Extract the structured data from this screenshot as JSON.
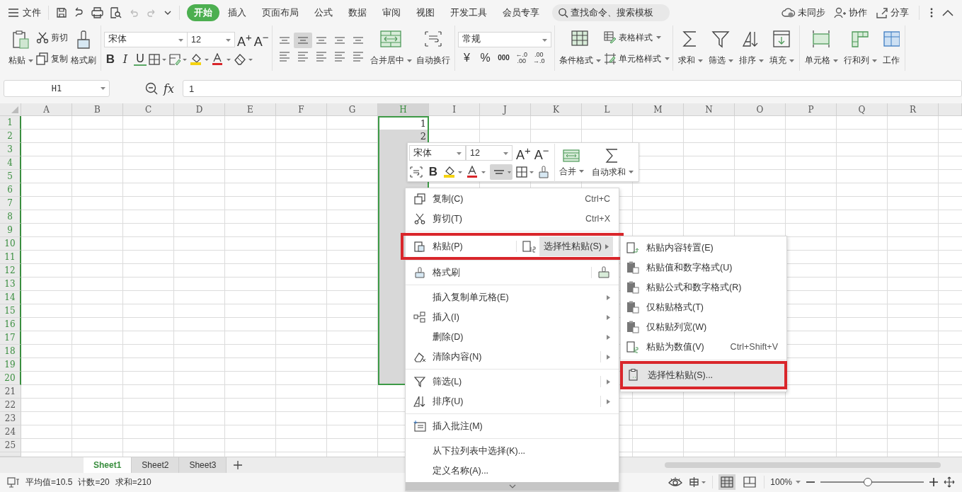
{
  "menu_bar": {
    "file": "文件",
    "tabs": [
      {
        "label": "开始",
        "selected": true
      },
      {
        "label": "插入",
        "selected": false
      },
      {
        "label": "页面布局",
        "selected": false
      },
      {
        "label": "公式",
        "selected": false
      },
      {
        "label": "数据",
        "selected": false
      },
      {
        "label": "审阅",
        "selected": false
      },
      {
        "label": "视图",
        "selected": false
      },
      {
        "label": "开发工具",
        "selected": false
      },
      {
        "label": "会员专享",
        "selected": false
      }
    ],
    "search": {
      "placeholder": "查找命令、搜索模板"
    },
    "actions": [
      "未同步",
      "协作",
      "分享"
    ]
  },
  "ribbon": {
    "clipboard": {
      "paste": "粘贴",
      "cut": "剪切",
      "copy": "复制",
      "painter": "格式刷"
    },
    "font": {
      "name": "宋体",
      "size": "12",
      "grow": "A$^{+}$",
      "shrink": "A$^{−}$",
      "bold": "B",
      "italic": "I",
      "underline": "U"
    },
    "alignment": {
      "merge": "合并居中",
      "wrap": "自动换行"
    },
    "number": {
      "format": "常规",
      "currency": "¥",
      "percent": "%",
      "thousands": "000",
      "decimals": [
        {
          "top": "←.0",
          "bottom": ".00"
        },
        {
          "top": ".00",
          "bottom": "→.0"
        }
      ]
    },
    "styles": {
      "conditional": "条件格式",
      "table_style": "表格样式",
      "cell_style": "单元格样式"
    },
    "editing": [
      "求和",
      "筛选",
      "排序",
      "填充"
    ],
    "cells": [
      "单元格",
      "行和列",
      "工作"
    ]
  },
  "formula_bar": {
    "name_box": "H1",
    "formula_label": "fx",
    "value": "1"
  },
  "sheet": {
    "columns": [
      {
        "label": "A",
        "selected": false
      },
      {
        "label": "B",
        "selected": false
      },
      {
        "label": "C",
        "selected": false
      },
      {
        "label": "D",
        "selected": false
      },
      {
        "label": "E",
        "selected": false
      },
      {
        "label": "F",
        "selected": false
      },
      {
        "label": "G",
        "selected": false
      },
      {
        "label": "H",
        "selected": true
      },
      {
        "label": "I",
        "selected": false
      },
      {
        "label": "J",
        "selected": false
      },
      {
        "label": "K",
        "selected": false
      },
      {
        "label": "L",
        "selected": false
      },
      {
        "label": "M",
        "selected": false
      },
      {
        "label": "N",
        "selected": false
      },
      {
        "label": "O",
        "selected": false
      },
      {
        "label": "P",
        "selected": false
      },
      {
        "label": "Q",
        "selected": false
      },
      {
        "label": "R",
        "selected": false
      }
    ],
    "rows": [
      {
        "label": "1",
        "selected": true,
        "value": "1"
      },
      {
        "label": "2",
        "selected": true,
        "value": "2"
      },
      {
        "label": "3",
        "selected": true
      },
      {
        "label": "4",
        "selected": true
      },
      {
        "label": "5",
        "selected": true
      },
      {
        "label": "6",
        "selected": true
      },
      {
        "label": "7",
        "selected": true
      },
      {
        "label": "8",
        "selected": true
      },
      {
        "label": "9",
        "selected": true
      },
      {
        "label": "10",
        "selected": true
      },
      {
        "label": "11",
        "selected": true
      },
      {
        "label": "12",
        "selected": true
      },
      {
        "label": "13",
        "selected": true
      },
      {
        "label": "14",
        "selected": true
      },
      {
        "label": "15",
        "selected": true
      },
      {
        "label": "16",
        "selected": true
      },
      {
        "label": "17",
        "selected": true
      },
      {
        "label": "18",
        "selected": true
      },
      {
        "label": "19",
        "selected": true
      },
      {
        "label": "20",
        "selected": true
      },
      {
        "label": "21",
        "selected": false
      },
      {
        "label": "22",
        "selected": false
      },
      {
        "label": "23",
        "selected": false
      },
      {
        "label": "24",
        "selected": false
      },
      {
        "label": "25",
        "selected": false
      }
    ],
    "tabs": [
      {
        "label": "Sheet1",
        "selected": true
      },
      {
        "label": "Sheet2",
        "selected": false
      },
      {
        "label": "Sheet3",
        "selected": false
      }
    ]
  },
  "mini_toolbar": {
    "font": "宋体",
    "size": "12",
    "grow": "A$^{+}$",
    "shrink": "A$^{−}$",
    "bold": "B",
    "merge": "合并",
    "autosum": "自动求和"
  },
  "context_menu": {
    "groups": [
      [
        {
          "label": "复制(C)",
          "kind": "plain",
          "shortcut": "Ctrl+C"
        },
        {
          "label": "剪切(T)",
          "kind": "plain",
          "shortcut": "Ctrl+X"
        }
      ],
      [
        {
          "label": "粘贴(P)",
          "kind": "paste",
          "outlined": true,
          "special": {
            "label": "选择性粘贴(S)",
            "selected": true
          }
        }
      ],
      [
        {
          "label": "格式刷",
          "kind": "tool"
        }
      ],
      [
        {
          "label": "插入复制单元格(E)",
          "kind": "submenu"
        },
        {
          "label": "插入(I)",
          "kind": "submenu"
        },
        {
          "label": "删除(D)",
          "kind": "submenu"
        },
        {
          "label": "清除内容(N)",
          "kind": "split"
        }
      ],
      [
        {
          "label": "筛选(L)",
          "kind": "split"
        },
        {
          "label": "排序(U)",
          "kind": "split"
        }
      ],
      [
        {
          "label": "插入批注(M)",
          "kind": "plain"
        }
      ],
      [
        {
          "label": "从下拉列表中选择(K)...",
          "kind": "plain"
        },
        {
          "label": "定义名称(A)...",
          "kind": "plain"
        }
      ]
    ]
  },
  "submenu": {
    "groups": [
      [
        {
          "label": "粘贴内容转置(E)",
          "selected": false,
          "outlined": false
        },
        {
          "label": "粘贴值和数字格式(U)",
          "selected": false,
          "outlined": false
        },
        {
          "label": "粘贴公式和数字格式(R)",
          "selected": false,
          "outlined": false
        },
        {
          "label": "仅粘贴格式(T)",
          "selected": false,
          "outlined": false
        },
        {
          "label": "仅粘贴列宽(W)",
          "selected": false,
          "outlined": false
        },
        {
          "label": "粘贴为数值(V)",
          "shortcut": "Ctrl+Shift+V",
          "selected": false,
          "outlined": false
        }
      ],
      [
        {
          "label": "选择性粘贴(S)...",
          "selected": true,
          "outlined": true
        }
      ]
    ]
  },
  "status_bar": {
    "stats": [
      "平均值=10.5",
      "计数=20",
      "求和=210"
    ],
    "zoom": "100%",
    "zoom_slider": {
      "level": 0.46
    }
  }
}
